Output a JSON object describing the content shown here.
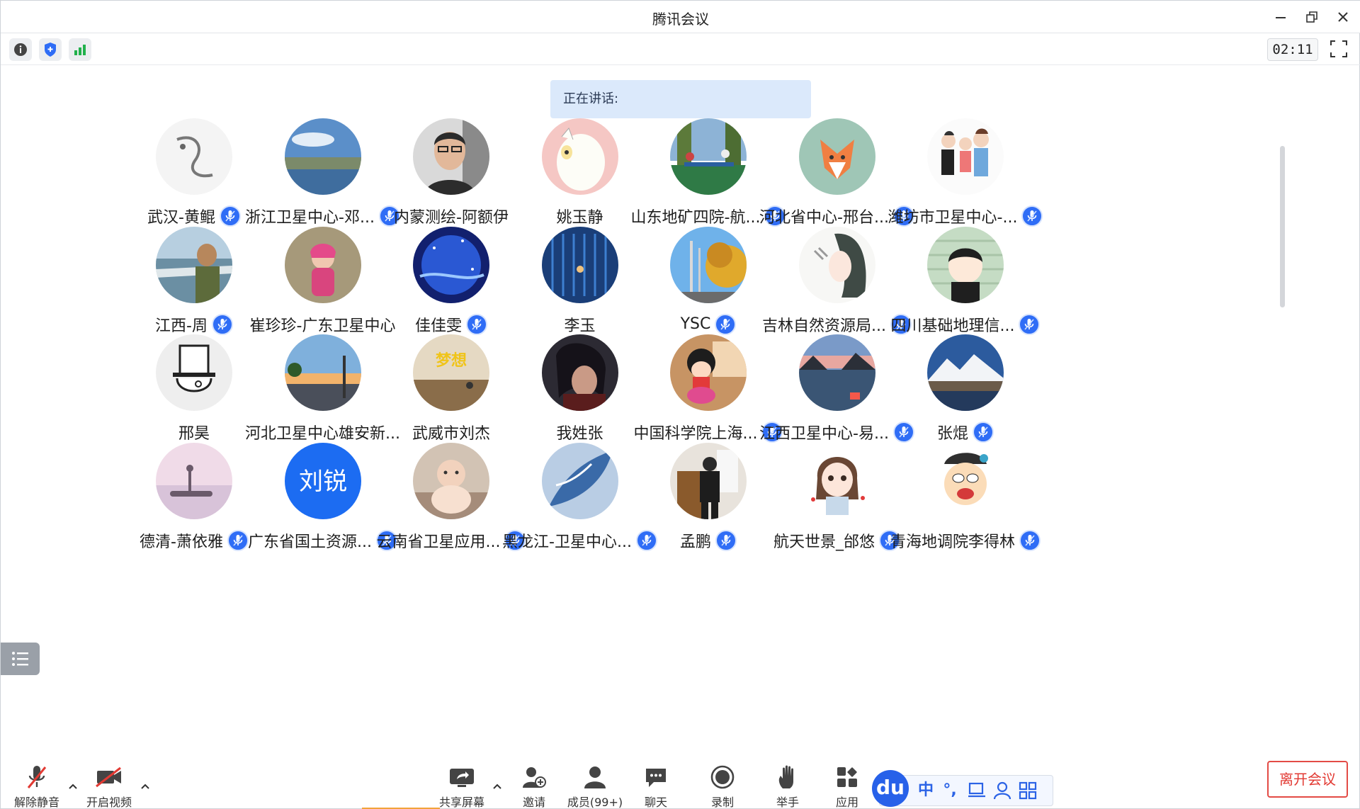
{
  "window": {
    "title": "腾讯会议"
  },
  "infobar": {
    "timer": "02:11"
  },
  "speaking": {
    "label": "正在讲话:"
  },
  "colors": {
    "accent": "#2f6df6",
    "leave": "#e23a33",
    "banner": "#dbe9fb"
  },
  "participants": [
    {
      "name": "武汉-黄鲲",
      "mic": true,
      "avatar": "sketch-swan"
    },
    {
      "name": "浙江卫星中心-邓...",
      "mic": true,
      "avatar": "lake-sky"
    },
    {
      "name": "内蒙测绘-阿额伊",
      "mic": false,
      "avatar": "man-photo"
    },
    {
      "name": "姚玉静",
      "mic": false,
      "avatar": "cartoon-cat"
    },
    {
      "name": "山东地矿四院-航...",
      "mic": true,
      "avatar": "playground"
    },
    {
      "name": "河北省中心-邢台...",
      "mic": true,
      "avatar": "paper-fox"
    },
    {
      "name": "潍坊市卫星中心-...",
      "mic": true,
      "avatar": "family-cartoon"
    },
    {
      "name": "江西-周",
      "mic": true,
      "avatar": "man-waterfront"
    },
    {
      "name": "崔珍珍-广东卫星中心",
      "mic": false,
      "avatar": "child-photo"
    },
    {
      "name": "佳佳雯",
      "mic": true,
      "avatar": "blue-night"
    },
    {
      "name": "李玉",
      "mic": false,
      "avatar": "blue-field"
    },
    {
      "name": "YSC",
      "mic": true,
      "avatar": "autumn-tree"
    },
    {
      "name": "吉林自然资源局...",
      "mic": true,
      "avatar": "girl-illustration"
    },
    {
      "name": "四川基础地理信...",
      "mic": true,
      "avatar": "boy-cartoon"
    },
    {
      "name": "邢昊",
      "mic": false,
      "avatar": "hat-sketch"
    },
    {
      "name": "河北卫星中心雄安新...",
      "mic": false,
      "avatar": "sunset-road"
    },
    {
      "name": "武威市刘杰",
      "mic": false,
      "avatar": "runner-poster"
    },
    {
      "name": "我姓张",
      "mic": false,
      "avatar": "dark-anime"
    },
    {
      "name": "中国科学院上海...",
      "mic": true,
      "avatar": "chibi-maruko"
    },
    {
      "name": "江西卫星中心-易...",
      "mic": true,
      "avatar": "sunset-lake"
    },
    {
      "name": "张焜",
      "mic": true,
      "avatar": "snow-mountain"
    },
    {
      "name": "德清-萧依雅",
      "mic": true,
      "avatar": "pastel-boat"
    },
    {
      "name": "广东省国土资源...",
      "mic": true,
      "avatar": "initials",
      "initials": "刘锐"
    },
    {
      "name": "云南省卫星应用...",
      "mic": true,
      "avatar": "baby-photo"
    },
    {
      "name": "黑龙江-卫星中心...",
      "mic": true,
      "avatar": "blue-feather"
    },
    {
      "name": "孟鹏",
      "mic": true,
      "avatar": "kid-room"
    },
    {
      "name": "航天世景_邰悠",
      "mic": true,
      "avatar": "girl-chibi"
    },
    {
      "name": "青海地调院李得林",
      "mic": true,
      "avatar": "funny-cartoon"
    }
  ],
  "toolbar": {
    "unmute": "解除静音",
    "start_video": "开启视频",
    "share_screen": "共享屏幕",
    "invite": "邀请",
    "members": "成员(99+)",
    "chat": "聊天",
    "record": "录制",
    "raise_hand": "举手",
    "apps": "应用",
    "leave": "离开会议"
  },
  "ime": {
    "logo": "du",
    "items": [
      "中",
      "°,"
    ]
  }
}
